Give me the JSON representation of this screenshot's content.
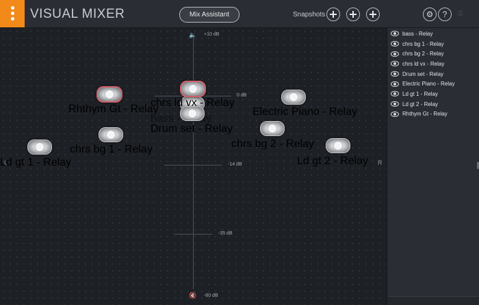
{
  "header": {
    "title": "VISUAL MIXER",
    "mix_assistant_label": "Mix Assistant",
    "snapshots_label": "Snapshots",
    "settings_glyph": "⚙",
    "help_glyph": "?",
    "logo_text": "iZ",
    "accent_color": "#f28a1a"
  },
  "stage": {
    "db_labels": {
      "top": "+10 dB",
      "zero": "0 dB",
      "minus14": "-14 dB",
      "minus35": "-35 dB",
      "bottom": "-60 dB"
    },
    "left_label": "L",
    "right_label": "R",
    "tracks": [
      {
        "id": "rhythm",
        "label": "Rhthym Gt - Relay",
        "selected": true
      },
      {
        "id": "chrs_ld",
        "label": "chrs ld vx - Relay",
        "selected": true
      },
      {
        "id": "bass",
        "label": "bass - Relay",
        "selected": false
      },
      {
        "id": "drum",
        "label": "Drum set - Relay",
        "selected": false
      },
      {
        "id": "piano",
        "label": "Electric Piano - Relay",
        "selected": false
      },
      {
        "id": "chrs1",
        "label": "chrs bg 1 - Relay",
        "selected": false
      },
      {
        "id": "chrs2",
        "label": "chrs bg 2 - Relay",
        "selected": false
      },
      {
        "id": "ld1",
        "label": "Ld gt 1 - Relay",
        "selected": false
      },
      {
        "id": "ld2",
        "label": "Ld gt 2 - Relay",
        "selected": false
      }
    ]
  },
  "panel": {
    "items": [
      {
        "label": "bass - Relay"
      },
      {
        "label": "chrs bg 1 - Relay"
      },
      {
        "label": "chrs bg 2 - Relay"
      },
      {
        "label": "chrs ld vx - Relay"
      },
      {
        "label": "Drum set - Relay"
      },
      {
        "label": "Electric Piano - Relay"
      },
      {
        "label": "Ld gt 1 - Relay"
      },
      {
        "label": "Ld gt 2 - Relay"
      },
      {
        "label": "Rhthym Gt - Relay"
      }
    ]
  }
}
